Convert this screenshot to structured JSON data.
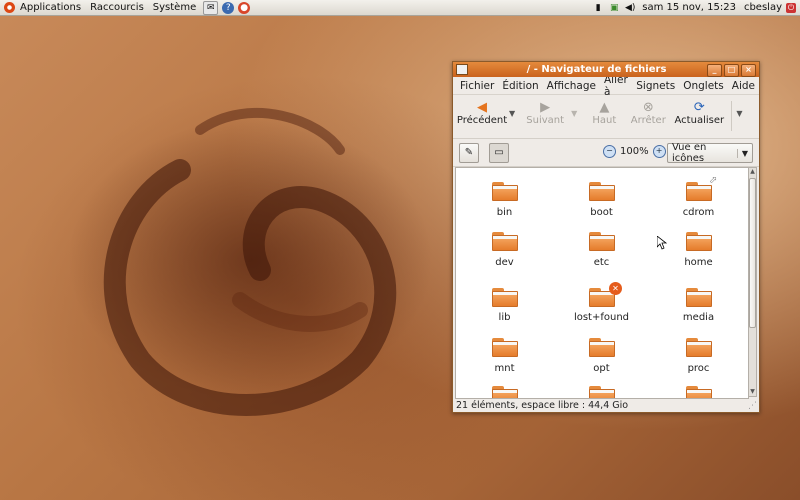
{
  "panel": {
    "menus": [
      "Applications",
      "Raccourcis",
      "Système"
    ],
    "clock": "sam 15 nov, 15:23",
    "user": "cbeslay"
  },
  "window": {
    "title": "/ - Navigateur de fichiers",
    "menu": [
      "Fichier",
      "Édition",
      "Affichage",
      "Aller à",
      "Signets",
      "Onglets",
      "Aide"
    ],
    "toolbar": {
      "back": "Précédent",
      "forward": "Suivant",
      "up": "Haut",
      "stop": "Arrêter",
      "reload": "Actualiser"
    },
    "zoom": "100%",
    "view_mode": "Vue en icônes",
    "items": [
      "bin",
      "boot",
      "cdrom",
      "dev",
      "etc",
      "home",
      "lib",
      "lost+found",
      "media",
      "mnt",
      "opt",
      "proc",
      "",
      "",
      ""
    ],
    "status": "21 éléments, espace libre : 44,4 Gio"
  }
}
